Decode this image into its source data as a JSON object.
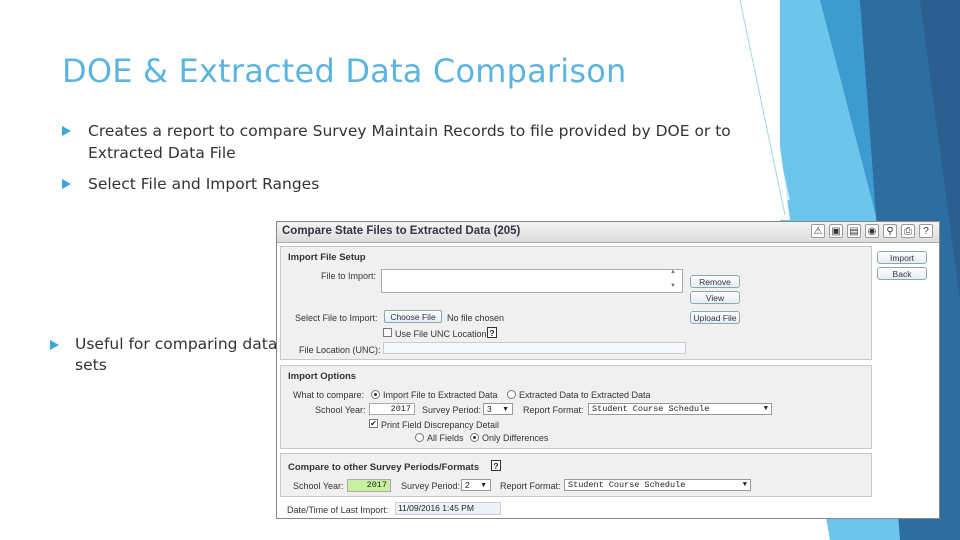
{
  "slide": {
    "title": "DOE & Extracted Data Comparison",
    "bullets": [
      "Creates a report to compare Survey Maintain Records to file provided by DOE or to Extracted Data File",
      "Select File and Import Ranges",
      "Useful for comparing data sets"
    ],
    "colors": {
      "title": "#5BB5E0",
      "bullet_arrow": "#3FA6D8"
    }
  },
  "app": {
    "window_title": "Compare State Files to Extracted Data (205)",
    "toolbar_icons": [
      "alert-icon",
      "image-icon",
      "save-icon",
      "camera-icon",
      "document-pin-icon",
      "print-icon",
      "help-icon"
    ],
    "toolbar_glyphs": [
      "⚠",
      "▣",
      "▤",
      "◉",
      "⚲",
      "⎙",
      "?"
    ],
    "buttons": {
      "import": "Import",
      "back": "Back"
    },
    "import_file_setup": {
      "title": "Import File Setup",
      "file_to_import_label": "File to Import:",
      "file_to_import_value": "",
      "remove": "Remove",
      "view": "View",
      "select_file_label": "Select File to Import:",
      "choose_file": "Choose File",
      "no_file": "No file chosen",
      "upload_file": "Upload File",
      "use_unc_label": "Use File UNC Location",
      "use_unc_help": "?",
      "unc_label": "File Location (UNC):",
      "unc_value": ""
    },
    "import_options": {
      "title": "Import Options",
      "what_to_compare_label": "What to compare:",
      "option_a": "Import File to Extracted Data",
      "option_b": "Extracted Data to Extracted Data",
      "school_year_label": "School Year:",
      "school_year": "2017",
      "survey_period_label": "Survey Period:",
      "survey_period": "3",
      "report_format_label": "Report Format:",
      "report_format": "Student Course Schedule",
      "print_detail_label": "Print Field Discrepancy Detail",
      "all_fields": "All Fields",
      "only_differences": "Only Differences"
    },
    "compare_other": {
      "title": "Compare to other Survey Periods/Formats",
      "help": "?",
      "school_year_label": "School Year:",
      "school_year": "2017",
      "survey_period_label": "Survey Period:",
      "survey_period": "2",
      "report_format_label": "Report Format:",
      "report_format": "Student Course Schedule"
    },
    "last_import": {
      "label": "Date/Time of Last Import:",
      "value": "11/09/2016  1:45 PM"
    }
  }
}
